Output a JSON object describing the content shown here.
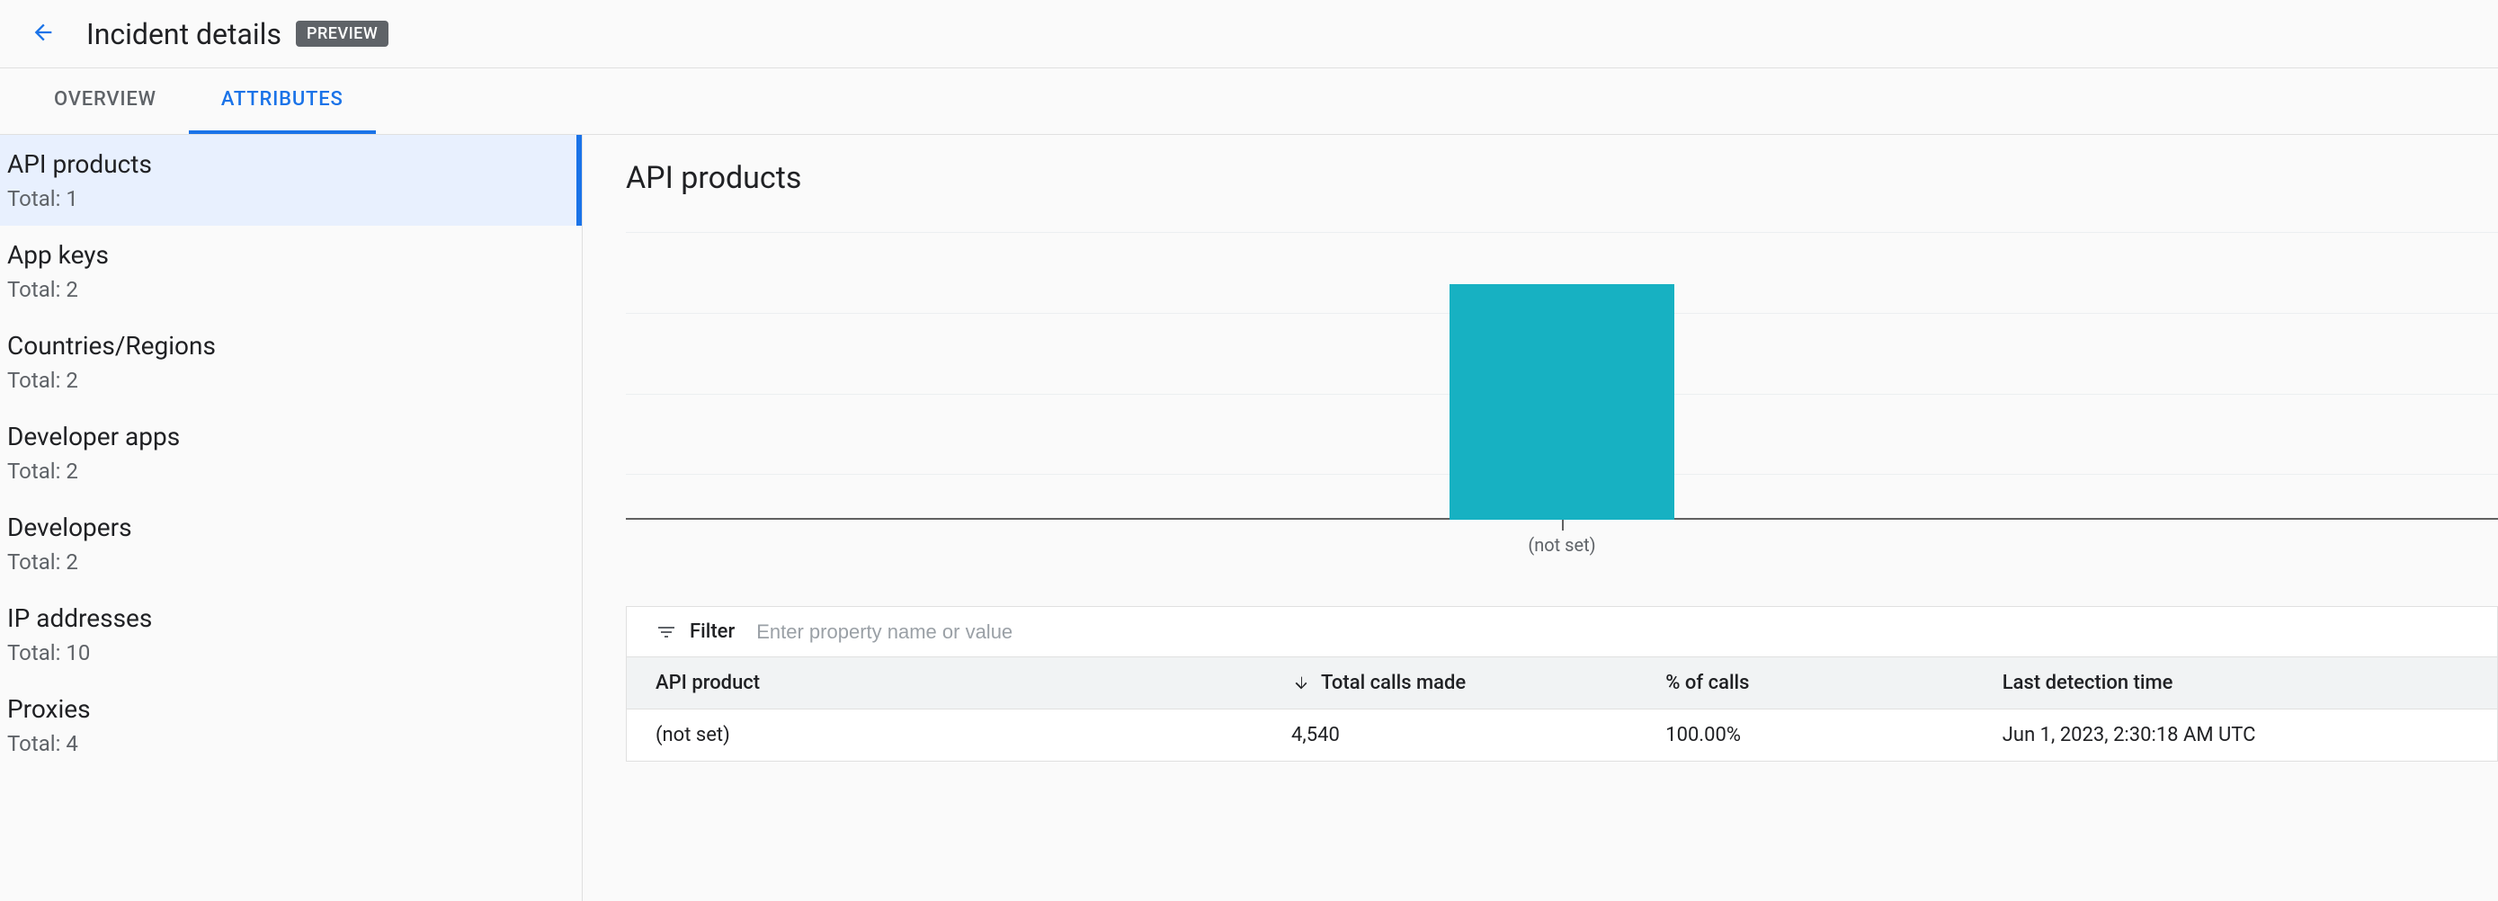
{
  "header": {
    "title": "Incident details",
    "badge": "PREVIEW"
  },
  "tabs": [
    {
      "id": "overview",
      "label": "OVERVIEW",
      "active": false
    },
    {
      "id": "attributes",
      "label": "ATTRIBUTES",
      "active": true
    }
  ],
  "sidebar": {
    "items": [
      {
        "label": "API products",
        "total_label": "Total: 1",
        "active": true
      },
      {
        "label": "App keys",
        "total_label": "Total: 2",
        "active": false
      },
      {
        "label": "Countries/Regions",
        "total_label": "Total: 2",
        "active": false
      },
      {
        "label": "Developer apps",
        "total_label": "Total: 2",
        "active": false
      },
      {
        "label": "Developers",
        "total_label": "Total: 2",
        "active": false
      },
      {
        "label": "IP addresses",
        "total_label": "Total: 10",
        "active": false
      },
      {
        "label": "Proxies",
        "total_label": "Total: 4",
        "active": false
      }
    ]
  },
  "main": {
    "section_title": "API products",
    "filter": {
      "label": "Filter",
      "placeholder": "Enter property name or value"
    },
    "table": {
      "columns": [
        {
          "id": "api_product",
          "label": "API product",
          "align": "left",
          "sorted": false
        },
        {
          "id": "calls",
          "label": "Total calls made",
          "align": "right",
          "sorted": "desc"
        },
        {
          "id": "pct",
          "label": "% of calls",
          "align": "right",
          "sorted": false
        },
        {
          "id": "last",
          "label": "Last detection time",
          "align": "left",
          "sorted": false
        }
      ],
      "rows": [
        {
          "api_product": "(not set)",
          "calls": "4,540",
          "pct": "100.00%",
          "last": "Jun 1, 2023, 2:30:18 AM UTC"
        }
      ]
    }
  },
  "chart_data": {
    "type": "bar",
    "categories": [
      "(not set)"
    ],
    "values": [
      4540
    ],
    "title": "",
    "xlabel": "",
    "ylabel": "",
    "bar_color": "#17b1c2"
  }
}
